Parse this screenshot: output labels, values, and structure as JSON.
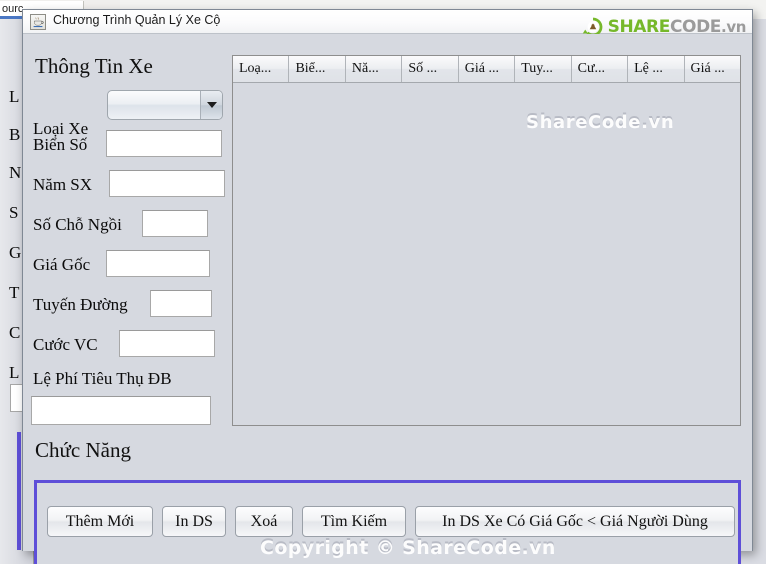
{
  "background": {
    "tab_label": "ourc",
    "labels": [
      "L",
      "B",
      "N",
      "S",
      "G",
      "T",
      "C",
      "L"
    ]
  },
  "window": {
    "title": "Chương Trình Quản Lý Xe Cộ",
    "icon": "java-coffee-cup-icon"
  },
  "logo": {
    "icon": "sharecode-circle-icon",
    "share": "SHARE",
    "code": "CODE",
    "vn": ".vn"
  },
  "form": {
    "title": "Thông Tin Xe",
    "fields": [
      {
        "label": "Loại Xe",
        "type": "combo",
        "value": "",
        "name": "vehicle-type"
      },
      {
        "label": "Biển Số",
        "type": "text",
        "value": "",
        "name": "license-plate"
      },
      {
        "label": "Năm SX",
        "type": "text",
        "value": "",
        "name": "year-made"
      },
      {
        "label": "Số Chỗ Ngồi",
        "type": "text",
        "value": "",
        "name": "seat-count"
      },
      {
        "label": "Giá Gốc",
        "type": "text",
        "value": "",
        "name": "base-price"
      },
      {
        "label": "Tuyến Đường",
        "type": "text",
        "value": "",
        "name": "route"
      },
      {
        "label": "Cước VC",
        "type": "text",
        "value": "",
        "name": "freight-fee"
      },
      {
        "label": "Lệ Phí Tiêu Thụ ĐB",
        "type": "text",
        "value": "",
        "name": "special-consumption-fee"
      }
    ]
  },
  "table": {
    "columns": [
      "Loạ...",
      "Biể...",
      "Nă...",
      "Số ...",
      "Giá ...",
      "Tuy...",
      "Cư...",
      "Lệ ...",
      "Giá ..."
    ],
    "rows": [],
    "watermark": "ShareCode.vn"
  },
  "functions": {
    "title": "Chức Năng",
    "buttons": [
      {
        "label": "Thêm Mới",
        "name": "add-new-button"
      },
      {
        "label": "In DS",
        "name": "print-list-button"
      },
      {
        "label": "Xoá",
        "name": "delete-button"
      },
      {
        "label": "Tìm Kiếm",
        "name": "search-button"
      },
      {
        "label": "In DS Xe Có Giá Gốc < Giá Người Dùng",
        "name": "print-filtered-list-button"
      }
    ]
  },
  "footer": {
    "copyright": "Copyright © ShareCode.vn"
  },
  "colors": {
    "accent_purple": "#5e4fd8",
    "logo_green": "#76b82a",
    "logo_gray": "#9b9b9b",
    "panel_bg": "#d6d9e0"
  }
}
